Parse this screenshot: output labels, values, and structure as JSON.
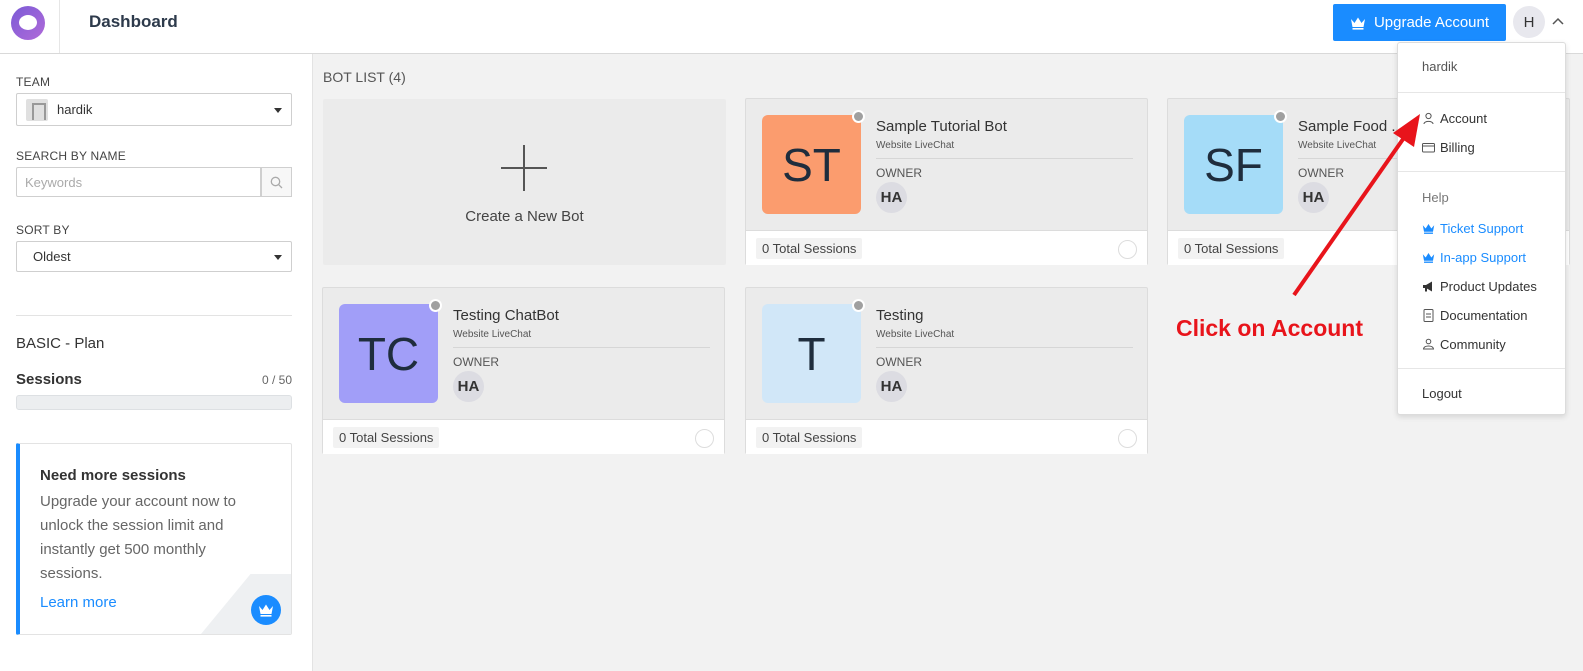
{
  "header": {
    "title": "Dashboard",
    "upgrade_label": "Upgrade Account",
    "avatar_initial": "H"
  },
  "sidebar": {
    "team_label": "TEAM",
    "team_value": "hardik",
    "search_label": "SEARCH BY NAME",
    "search_placeholder": "Keywords",
    "sort_label": "SORT BY",
    "sort_value": "Oldest",
    "plan_name": "BASIC - Plan",
    "sessions_label": "Sessions",
    "sessions_count": "0 / 50",
    "sessions_used_fraction": 0,
    "upsell": {
      "title": "Need more sessions",
      "body": "Upgrade your account now to unlock the session limit and instantly get 500 monthly sessions.",
      "link": "Learn more"
    }
  },
  "main": {
    "bot_list_title": "BOT LIST (4)",
    "create_label": "Create a New Bot",
    "bots": [
      {
        "initials": "ST",
        "name": "Sample Tutorial Bot",
        "type": "Website LiveChat",
        "owner_label": "OWNER",
        "owner": "HA",
        "sessions": "0 Total Sessions",
        "color": "#fb9c6e"
      },
      {
        "initials": "SF",
        "name": "Sample Food ...",
        "type": "Website LiveChat",
        "owner_label": "OWNER",
        "owner": "HA",
        "sessions": "0 Total Sessions",
        "color": "#a5dcf8"
      },
      {
        "initials": "TC",
        "name": "Testing ChatBot",
        "type": "Website LiveChat",
        "owner_label": "OWNER",
        "owner": "HA",
        "sessions": "0 Total Sessions",
        "color": "#a19ef8"
      },
      {
        "initials": "T",
        "name": "Testing",
        "type": "Website LiveChat",
        "owner_label": "OWNER",
        "owner": "HA",
        "sessions": "0 Total Sessions",
        "color": "#d1e7f8"
      }
    ]
  },
  "menu": {
    "user": "hardik",
    "items": [
      {
        "label": "Account",
        "icon": "user-icon"
      },
      {
        "label": "Billing",
        "icon": "card-icon"
      }
    ],
    "help_heading": "Help",
    "help_items": [
      {
        "label": "Ticket Support",
        "icon": "crown-icon"
      },
      {
        "label": "In-app Support",
        "icon": "crown-icon"
      },
      {
        "label": "Product Updates",
        "icon": "megaphone-icon"
      },
      {
        "label": "Documentation",
        "icon": "document-icon"
      },
      {
        "label": "Community",
        "icon": "community-icon"
      }
    ],
    "logout": "Logout"
  },
  "annotation": {
    "text": "Click on Account",
    "color": "#e8141b"
  },
  "colors": {
    "accent": "#1a8cff"
  }
}
